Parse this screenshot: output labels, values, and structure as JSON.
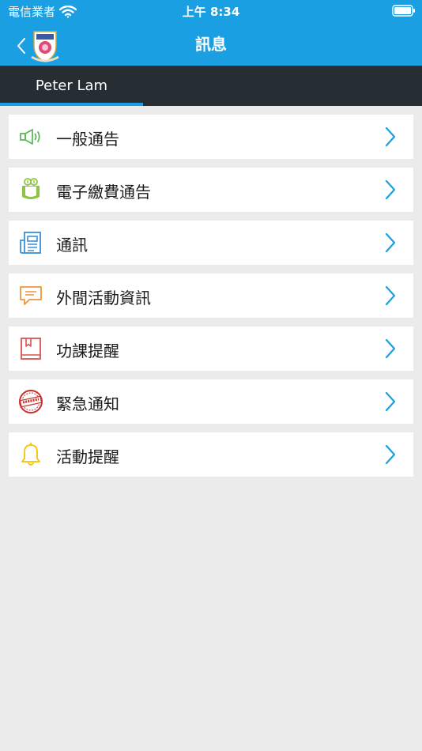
{
  "status_bar": {
    "carrier": "電信業者",
    "time": "上午 8:34"
  },
  "nav": {
    "title": "訊息"
  },
  "tabs": [
    {
      "label": "Peter Lam",
      "active": true
    }
  ],
  "menu": [
    {
      "label": "一般通告",
      "icon": "megaphone-icon",
      "color": "#5cb85c"
    },
    {
      "label": "電子繳費通告",
      "icon": "money-bag-icon",
      "color": "#8cc63f"
    },
    {
      "label": "通訊",
      "icon": "newsletter-icon",
      "color": "#3a8fd6"
    },
    {
      "label": "外間活動資訊",
      "icon": "chat-bubble-icon",
      "color": "#f0953a"
    },
    {
      "label": "功課提醒",
      "icon": "book-icon",
      "color": "#d9534f"
    },
    {
      "label": "緊急通知",
      "icon": "urgent-stamp-icon",
      "color": "#c9302c"
    },
    {
      "label": "活動提醒",
      "icon": "bell-icon",
      "color": "#f5c400"
    }
  ],
  "colors": {
    "accent": "#1aa0e2",
    "tab_bar": "#262d33",
    "background": "#ebebeb"
  }
}
